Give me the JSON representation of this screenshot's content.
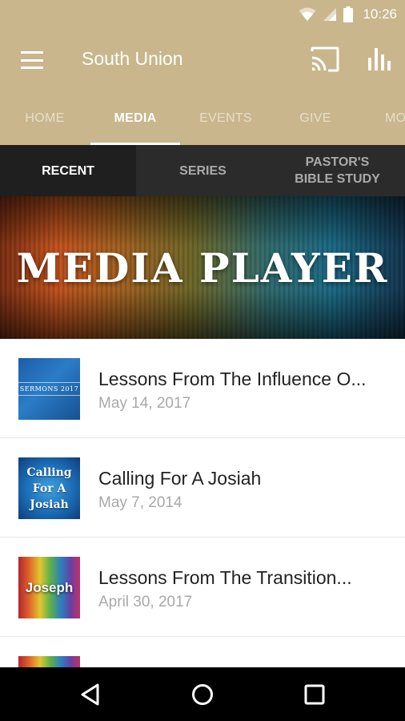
{
  "status_bar": {
    "time": "10:26"
  },
  "app": {
    "title": "South Union"
  },
  "tabs": [
    {
      "label": "HOME"
    },
    {
      "label": "MEDIA"
    },
    {
      "label": "EVENTS"
    },
    {
      "label": "GIVE"
    },
    {
      "label": "MO"
    }
  ],
  "subtabs": [
    {
      "label": "RECENT"
    },
    {
      "label": "SERIES"
    },
    {
      "label": "PASTOR'S BIBLE STUDY"
    }
  ],
  "banner": {
    "title": "MEDIA PLAYER"
  },
  "media_items": [
    {
      "title": "Lessons From The Influence O...",
      "date": "May 14, 2017",
      "thumb_text": "SERMONS 2017"
    },
    {
      "title": "Calling For A Josiah",
      "date": "May 7, 2014",
      "thumb_text": "Calling For A Josiah"
    },
    {
      "title": "Lessons From The Transition...",
      "date": "April 30, 2017",
      "thumb_text": "Joseph"
    }
  ],
  "colors": {
    "brand": "#c9b68c",
    "subtab_bar": "#2b2b2b",
    "nav_bar": "#000000"
  }
}
